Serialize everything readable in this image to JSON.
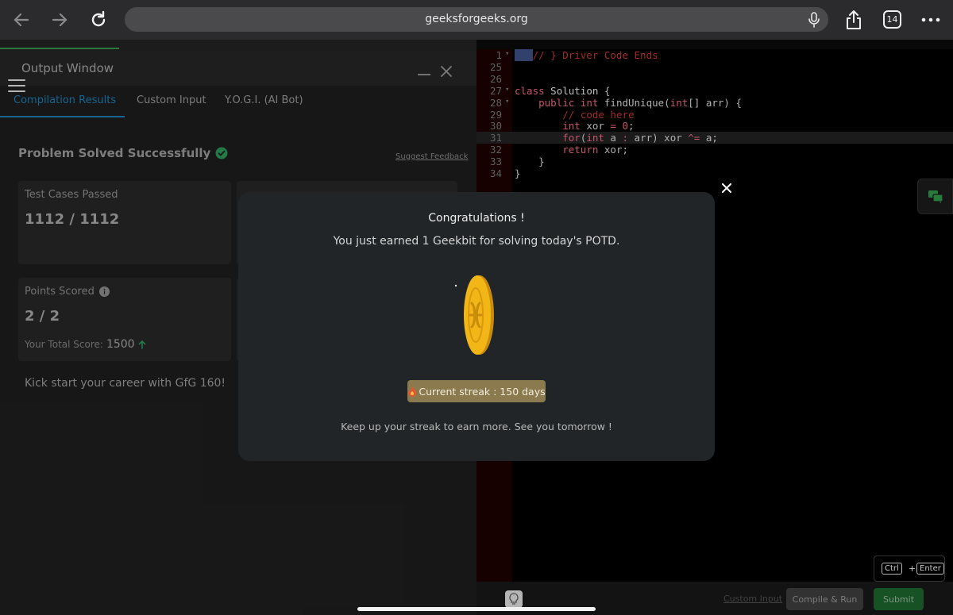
{
  "browser": {
    "url": "geeksforgeeks.org",
    "tab_count": "14"
  },
  "output_window": {
    "title": "Output Window",
    "tabs": [
      {
        "label": "Compilation Results"
      },
      {
        "label": "Custom Input"
      },
      {
        "label": "Y.O.G.I. (AI Bot)"
      }
    ],
    "status": "Problem Solved Successfully",
    "feedback_link": "Suggest Feedback",
    "test_cases": {
      "label": "Test Cases Passed",
      "value": "1112 / 1112"
    },
    "points": {
      "label": "Points Scored",
      "value": "2 / 2",
      "total_label": "Your Total Score:",
      "total_value": "1500"
    },
    "promo": "Kick start your career with GfG 160!"
  },
  "editor": {
    "lines": [
      {
        "n": "1",
        "fold": true,
        "html": "<span class='mark'>...</span><span class='cm'>// } Driver Code Ends</span>"
      },
      {
        "n": "25",
        "fold": false,
        "html": ""
      },
      {
        "n": "26",
        "fold": false,
        "html": ""
      },
      {
        "n": "27",
        "fold": true,
        "html": "<span class='kw'>class</span> <span class='cls'>Solution</span> {"
      },
      {
        "n": "28",
        "fold": true,
        "html": "    <span class='kw'>public</span> <span class='kw'>int</span> findUnique(<span class='kw'>int</span>[] arr) {"
      },
      {
        "n": "29",
        "fold": false,
        "html": "        <span class='cm'>// code here</span>"
      },
      {
        "n": "30",
        "fold": false,
        "html": "        <span class='kw'>int</span> xor <span class='kw'>=</span> <span class='kw'>0</span>;"
      },
      {
        "n": "31",
        "fold": false,
        "html": "        <span class='kw'>for</span>(<span class='kw'>int</span> a <span class='kw'>:</span> arr) xor <span class='kw'>^=</span> a;"
      },
      {
        "n": "32",
        "fold": false,
        "html": "        <span class='kw'>return</span> xor;"
      },
      {
        "n": "33",
        "fold": false,
        "html": "    }"
      },
      {
        "n": "34",
        "fold": false,
        "html": "}"
      }
    ],
    "custom_input_link": "Custom Input",
    "compile_label": "Compile & Run",
    "submit_label": "Submit",
    "shortcut": {
      "key1": "Ctrl",
      "plus": "+",
      "key2": "Enter"
    }
  },
  "modal": {
    "title": "Congratulations !",
    "subtitle": "You just earned 1 Geekbit for solving today's POTD.",
    "streak": "Current streak : 150 days",
    "footer": "Keep up your streak to earn more. See you tomorrow !"
  },
  "colors": {
    "brand_green": "#2f8d46",
    "tab_blue": "#1a73a8",
    "coin_gold": "#f2b616",
    "streak_bg": "#8a7a4e"
  }
}
